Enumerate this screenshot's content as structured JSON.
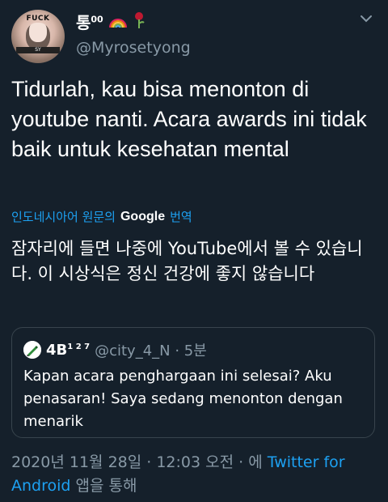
{
  "user": {
    "display_name": "통",
    "display_name_sup": "00",
    "handle": "@Myrosetyong",
    "avatar_top_text": "FUCK",
    "avatar_strip_text": "SY"
  },
  "tweet": {
    "text": "Tidurlah, kau bisa menonton di youtube nanti. Acara awards ini tidak baik untuk kesehatan mental",
    "translate_prefix": "인도네시아어 원문의",
    "translate_google": "Google",
    "translate_suffix": "번역",
    "translated_text": "잠자리에 들면 나중에 YouTube에서 볼 수 있습니다. 이 시상식은 정신 건강에 좋지 않습니다"
  },
  "quote": {
    "name": "4B",
    "name_sup": "1 2 7",
    "meta": "@city_4_N · 5분",
    "text": "Kapan acara penghargaan ini selesai?  Aku penasaran! Saya sedang menonton dengan menarik"
  },
  "footer": {
    "timestamp": "2020년 11월 28일 · 12:03 오전 · 에 ",
    "client": "Twitter for Android",
    "suffix": " 앱을 통해"
  },
  "colors": {
    "background": "#15202b",
    "link": "#1da1f2",
    "secondary_text": "#8899a6",
    "border": "#38444d"
  },
  "icons": [
    "rainbow-icon",
    "rose-icon",
    "chevron-down-icon",
    "pen-icon"
  ]
}
